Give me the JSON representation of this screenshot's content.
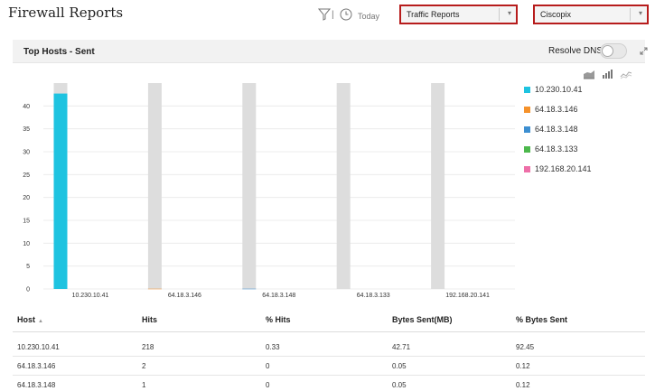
{
  "page_title": "Firewall Reports",
  "toolbar": {
    "filter_icon": "filter-icon",
    "separator": "|",
    "clock_icon": "clock-icon",
    "period_label": "Today",
    "report_type": "Traffic Reports",
    "device": "Ciscopix"
  },
  "panel": {
    "title": "Top Hosts - Sent",
    "resolve_dns_label": "Resolve DNS",
    "resolve_dns_enabled": false,
    "chart_type_icons": [
      "area-chart-icon",
      "bar-chart-icon",
      "line-chart-icon"
    ]
  },
  "chart_data": {
    "type": "bar",
    "stacked": true,
    "categories": [
      "10.230.10.41",
      "64.18.3.146",
      "64.18.3.148",
      "64.18.3.133",
      "192.168.20.141"
    ],
    "series": [
      {
        "name": "10.230.10.41",
        "color": "#1ec3e0",
        "values": [
          42.71,
          0,
          0,
          0,
          0
        ]
      },
      {
        "name": "64.18.3.146",
        "color": "#f5922b",
        "values": [
          0,
          0.05,
          0,
          0,
          0
        ]
      },
      {
        "name": "64.18.3.148",
        "color": "#3d8fd1",
        "values": [
          0,
          0,
          0.05,
          0,
          0
        ]
      },
      {
        "name": "64.18.3.133",
        "color": "#4cb84c",
        "values": [
          0,
          0,
          0,
          0,
          0
        ]
      },
      {
        "name": "192.168.20.141",
        "color": "#ee6fa8",
        "values": [
          0,
          0,
          0,
          0,
          0
        ]
      }
    ],
    "y_ticks": [
      0,
      5,
      10,
      15,
      20,
      25,
      30,
      35,
      40
    ],
    "ylim": [
      0,
      45
    ],
    "background_bar_color": "#dddddd",
    "grid": true
  },
  "table": {
    "columns": [
      "Host",
      "Hits",
      "% Hits",
      "Bytes Sent(MB)",
      "% Bytes Sent"
    ],
    "sort_icon": "sort-asc-icon",
    "rows": [
      [
        "10.230.10.41",
        "218",
        "0.33",
        "42.71",
        "92.45"
      ],
      [
        "64.18.3.146",
        "2",
        "0",
        "0.05",
        "0.12"
      ],
      [
        "64.18.3.148",
        "1",
        "0",
        "0.05",
        "0.12"
      ]
    ]
  }
}
